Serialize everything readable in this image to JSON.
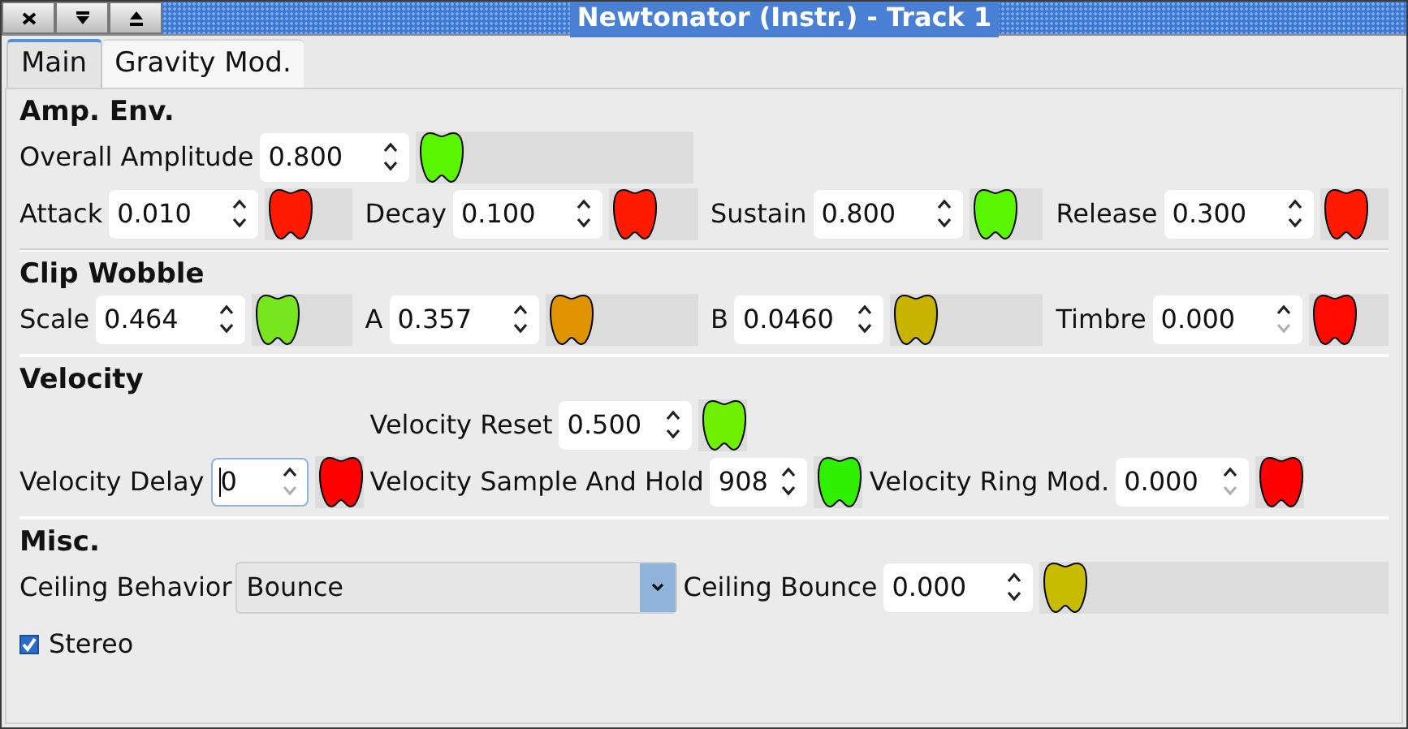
{
  "window": {
    "title": "Newtonator (Instr.) - Track 1"
  },
  "tabs": [
    {
      "label": "Main",
      "selected": true
    },
    {
      "label": "Gravity Mod.",
      "selected": false
    }
  ],
  "sections": [
    {
      "title": "Amp. Env.",
      "rows": [
        [
          {
            "kind": "spin",
            "label": "Overall Amplitude",
            "value": "0.800",
            "color": "#5af500",
            "down_disabled": false,
            "focused": false
          }
        ],
        [
          {
            "kind": "spin",
            "label": "Attack",
            "value": "0.010",
            "color": "#ff1a00",
            "down_disabled": false,
            "focused": false
          },
          {
            "kind": "spin",
            "label": "Decay",
            "value": "0.100",
            "color": "#ff1a00",
            "down_disabled": false,
            "focused": false
          },
          {
            "kind": "spin",
            "label": "Sustain",
            "value": "0.800",
            "color": "#5af500",
            "down_disabled": false,
            "focused": false
          },
          {
            "kind": "spin",
            "label": "Release",
            "value": "0.300",
            "color": "#ff1a00",
            "down_disabled": false,
            "focused": false
          }
        ]
      ]
    },
    {
      "title": "Clip Wobble",
      "rows": [
        [
          {
            "kind": "spin",
            "label": "Scale",
            "value": "0.464",
            "color": "#78e61e",
            "down_disabled": false,
            "focused": false
          },
          {
            "kind": "spin",
            "label": "A",
            "value": "0.357",
            "color": "#e09400",
            "down_disabled": false,
            "focused": false
          },
          {
            "kind": "spin",
            "label": "B",
            "value": "0.0460",
            "color": "#c8b400",
            "down_disabled": false,
            "focused": false
          },
          {
            "kind": "spin",
            "label": "Timbre",
            "value": "0.000",
            "color": "#ff0a00",
            "down_disabled": true,
            "focused": false
          }
        ]
      ]
    },
    {
      "title": "Velocity",
      "rows": [
        [
          "",
          {
            "kind": "spin",
            "label": "Velocity Reset",
            "value": "0.500",
            "color": "#6ef000",
            "down_disabled": false,
            "focused": false
          }
        ],
        [
          {
            "kind": "spin",
            "label": "Velocity Delay",
            "value": "0",
            "color": "#ff0000",
            "down_disabled": true,
            "focused": true
          },
          {
            "kind": "spin",
            "label": "Velocity Sample And Hold",
            "value": "908",
            "color": "#2ef000",
            "down_disabled": false,
            "focused": false
          },
          {
            "kind": "spin",
            "label": "Velocity Ring Mod.",
            "value": "0.000",
            "color": "#ff0000",
            "down_disabled": true,
            "focused": false
          }
        ]
      ]
    },
    {
      "title": "Misc.",
      "rows": [
        [
          {
            "kind": "combo",
            "label": "Ceiling Behavior",
            "value": "Bounce"
          },
          {
            "kind": "spin",
            "label": "Ceiling Bounce",
            "value": "0.000",
            "color": "#c8bc00",
            "down_disabled": false,
            "focused": false
          }
        ],
        [
          {
            "kind": "checkbox",
            "label": "Stereo",
            "checked": true
          }
        ]
      ]
    }
  ]
}
